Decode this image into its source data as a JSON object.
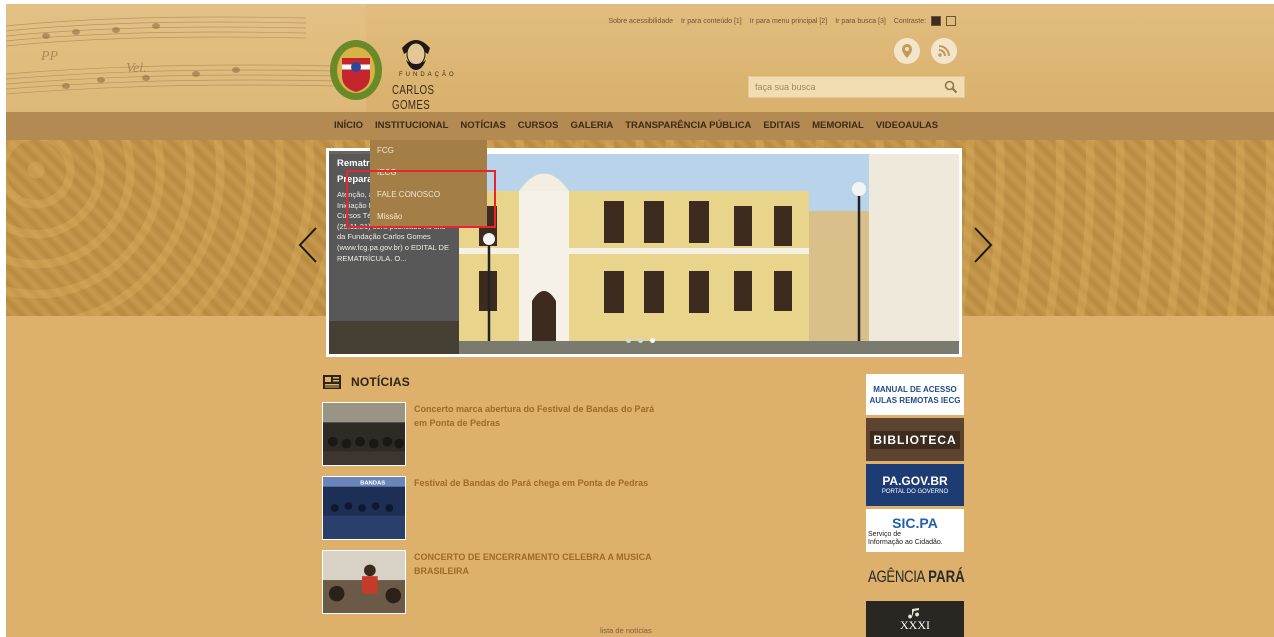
{
  "accessibility": {
    "links": [
      "Sobre acessibilidade",
      "Ir para conteúdo [1]",
      "Ir para menu principal [2]",
      "Ir para busca [3]"
    ],
    "contrast_label": "Contraste:"
  },
  "logo": {
    "line1": "FUNDAÇÃO",
    "line2": "CARLOS GOMES"
  },
  "search": {
    "placeholder": "faça sua busca"
  },
  "nav": [
    "INÍCIO",
    "INSTITUCIONAL",
    "NOTÍCIAS",
    "CURSOS",
    "GALERIA",
    "TRANSPARÊNCIA PÚBLICA",
    "EDITAIS",
    "MEMORIAL",
    "VIDEOAULAS"
  ],
  "dropdown": [
    "FCG",
    "IECG",
    "FALE CONOSCO",
    "Missão"
  ],
  "slide": {
    "title": "Rematrícula Iniciação Preparatório Técnico",
    "text": "Atenção, alunos do Curso de Iniciação Musical, Preparatório e Cursos Técnicos, amanhã (25.11.21) será publicado no site da Fundação Carlos Gomes (www.fcg.pa.gov.br) o EDITAL DE REMATRÍCULA. O..."
  },
  "news": {
    "heading": "NOTÍCIAS",
    "items": [
      {
        "title": "Concerto marca abertura do Festival de Bandas do Pará em Ponta de Pedras"
      },
      {
        "title": "Festival de Bandas do Pará chega em Ponta de Pedras"
      },
      {
        "title": "CONCERTO DE ENCERRAMENTO CELEBRA A MUSICA BRASILEIRA"
      }
    ],
    "more": "lista de notícias"
  },
  "side": {
    "manual": [
      "MANUAL DE ACESSO",
      "AULAS REMOTAS IECG"
    ],
    "biblioteca": "BIBLIOTECA",
    "pagov": [
      "PA.GOV.BR",
      "PORTAL DO GOVERNO"
    ],
    "sicpa": [
      "SIC.PA",
      "Serviço de",
      "Informação ao Cidadão."
    ],
    "agencia": [
      "AGÊNCIA",
      "PARÁ"
    ],
    "xxxi": "XXXI"
  },
  "colors": {
    "accent": "#e8242c",
    "nav_bg": "#b38a52",
    "page_bg": "#ddb06b"
  }
}
